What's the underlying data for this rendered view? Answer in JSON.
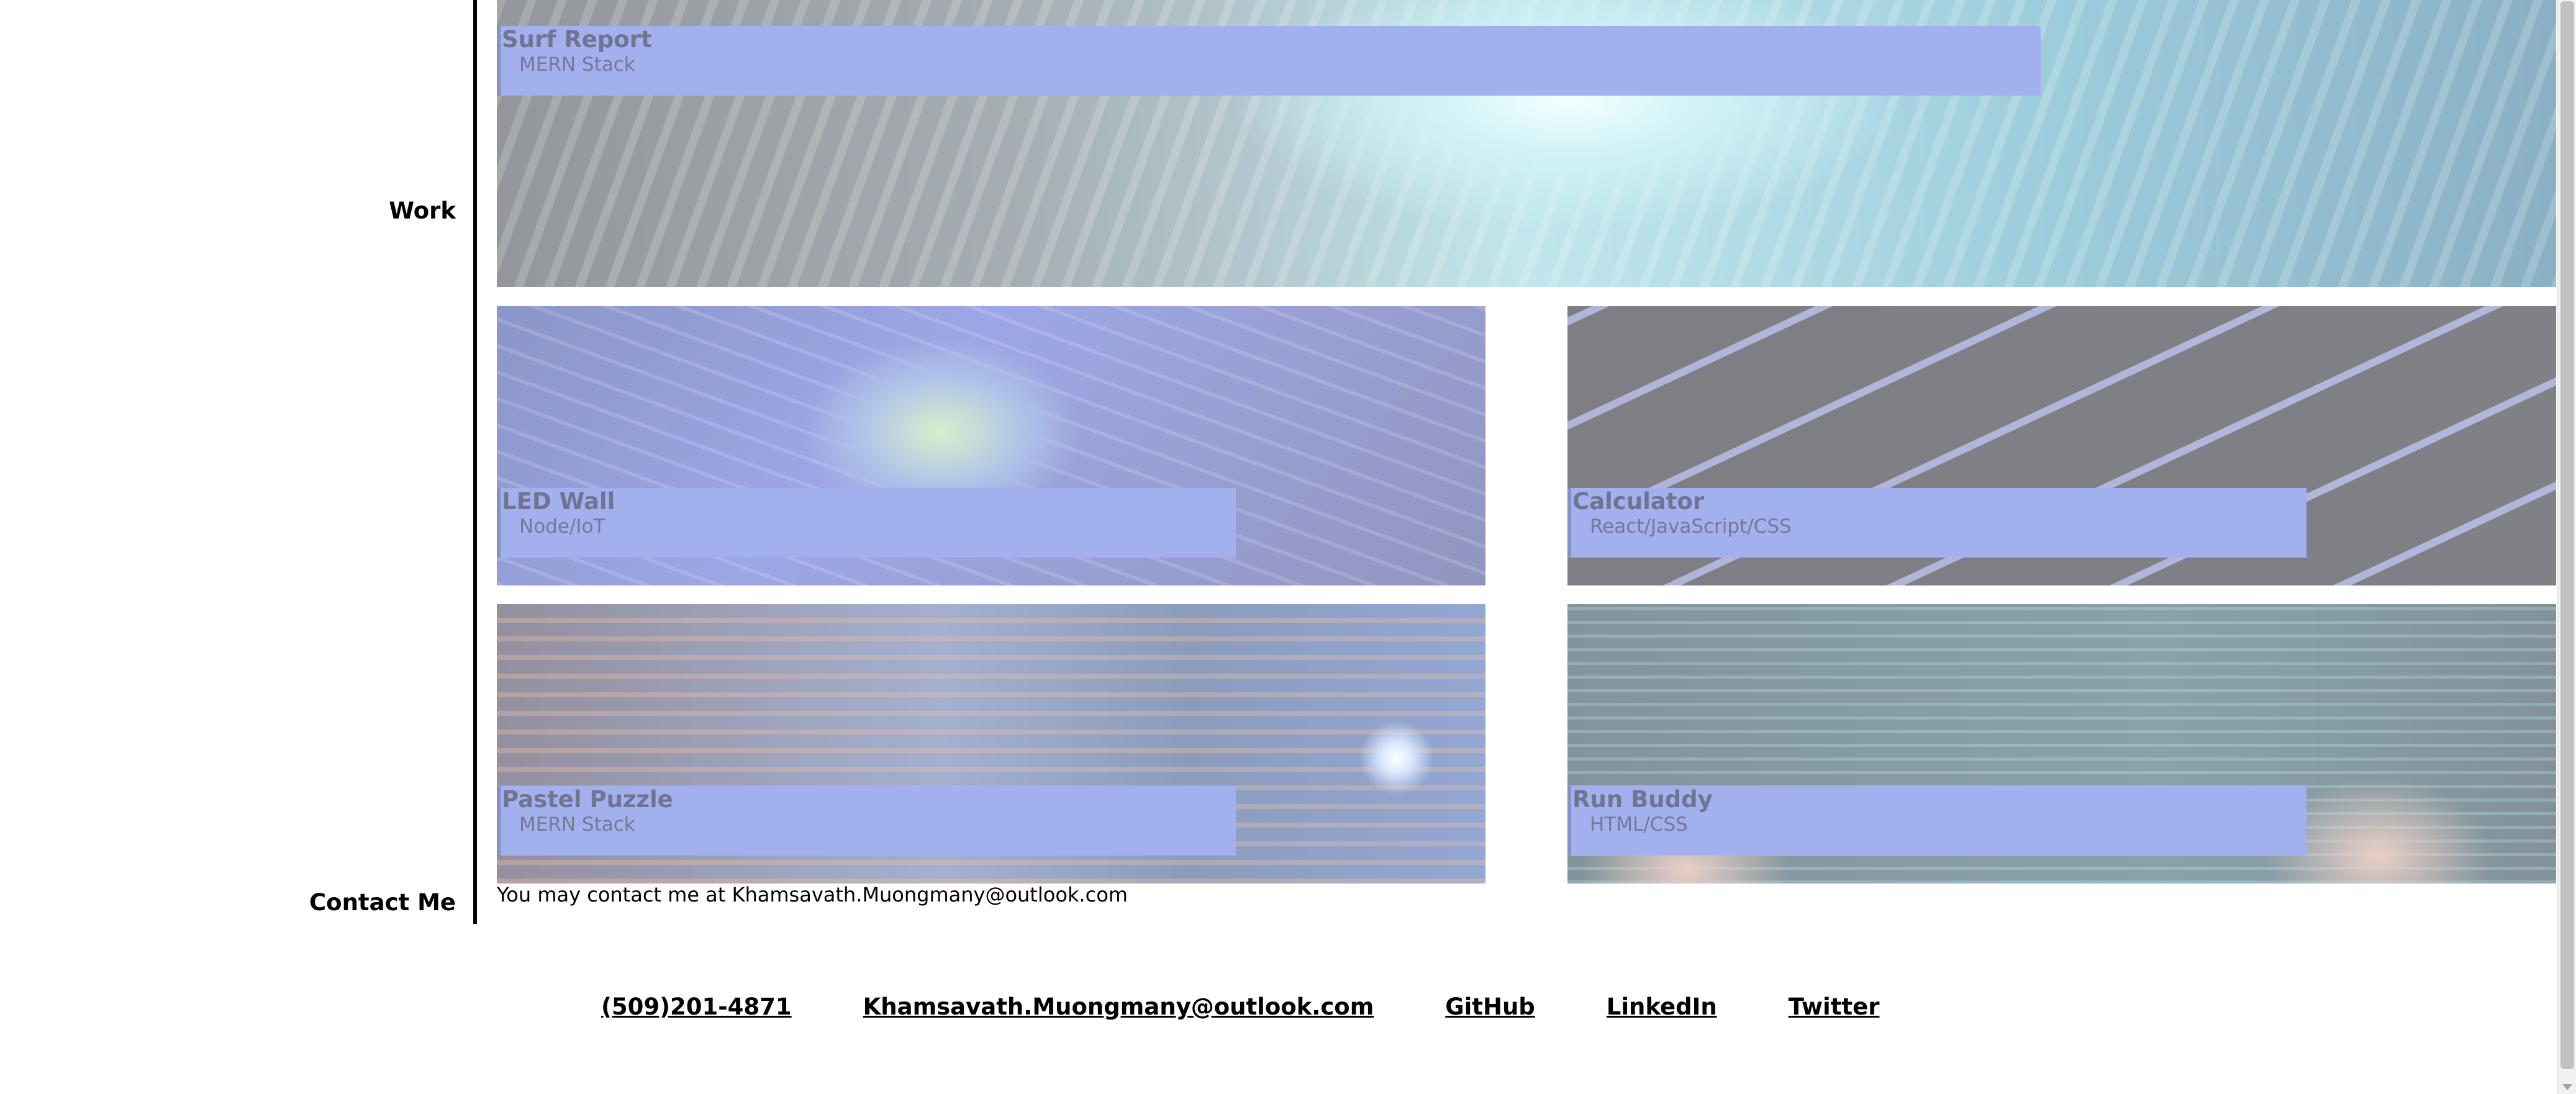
{
  "sections": {
    "work": "Work",
    "contact": "Contact Me"
  },
  "projects": [
    {
      "title": "Surf Report",
      "stack": "MERN Stack",
      "image": "binary-code-wave-image"
    },
    {
      "title": "LED Wall",
      "stack": "Node/IoT",
      "image": "circuit-board-chip-image"
    },
    {
      "title": "Calculator",
      "stack": "React/JavaScript/CSS",
      "image": "keyboard-keys-image"
    },
    {
      "title": "Pastel Puzzle",
      "stack": "MERN Stack",
      "image": "code-on-screen-image"
    },
    {
      "title": "Run Buddy",
      "stack": "HTML/CSS",
      "image": "hands-typing-code-image"
    }
  ],
  "contact_text": "You may contact me at Khamsavath.Muongmany@outlook.com",
  "footer": {
    "phone": "(509)201-4871",
    "email": "Khamsavath.Muongmany@outlook.com",
    "github": "GitHub",
    "linkedin": "LinkedIn",
    "twitter": "Twitter"
  },
  "colors": {
    "label_bg": "#a2b0ee",
    "label_text": "#6f7590"
  }
}
